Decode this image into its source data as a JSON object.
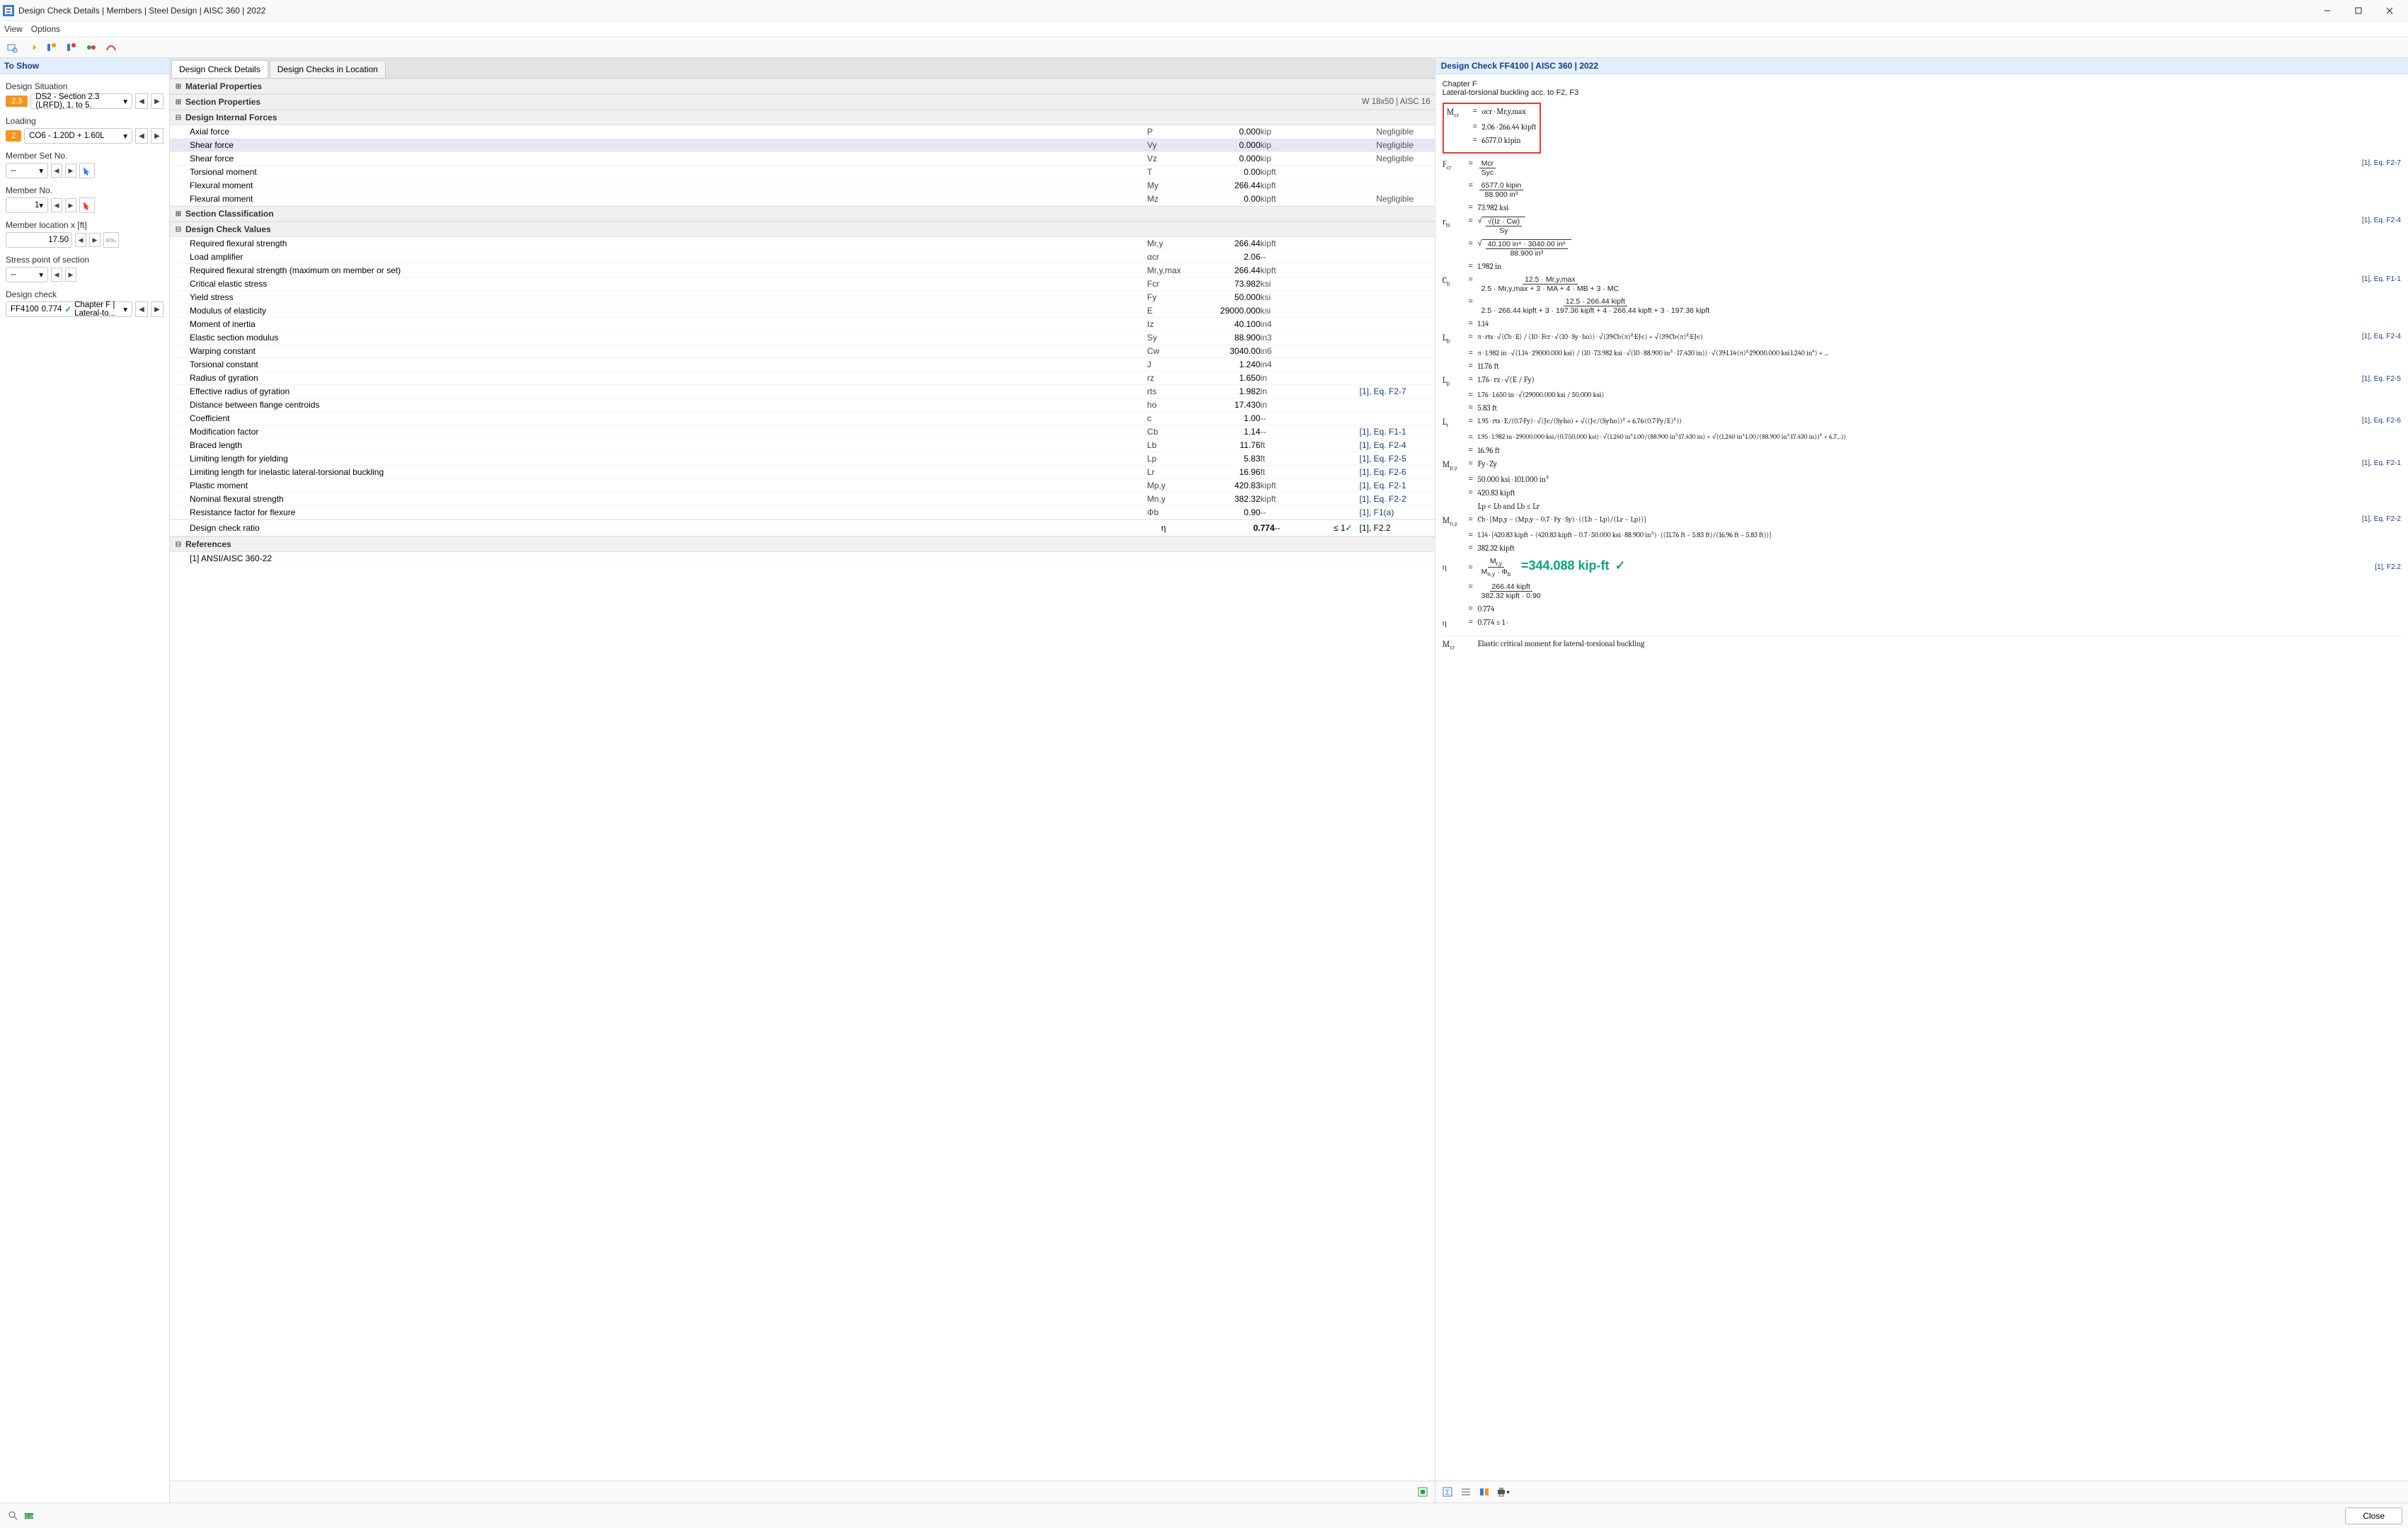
{
  "window": {
    "title": "Design Check Details | Members | Steel Design | AISC 360 | 2022"
  },
  "menus": {
    "view": "View",
    "options": "Options"
  },
  "leftPane": {
    "header": "To Show",
    "designSituationLabel": "Design Situation",
    "dsBadge": "2.3",
    "dsText": "DS2 - Section 2.3 (LRFD), 1. to 5.",
    "loadingLabel": "Loading",
    "loadBadge": "2",
    "loadText": "CO6 - 1.20D + 1.60L",
    "memberSetLabel": "Member Set No.",
    "memberSetVal": "--",
    "memberNoLabel": "Member No.",
    "memberNoVal": "1",
    "memberLocLabel": "Member location x [ft]",
    "memberLocVal": "17.50",
    "spLabel": "Stress point of section",
    "spVal": "--",
    "dcLabel": "Design check",
    "dcCode": "FF4100",
    "dcRatio": "0.774",
    "dcText": "Chapter F | Lateral-to..."
  },
  "midPane": {
    "tab1": "Design Check Details",
    "tab2": "Design Checks in Location",
    "groups": {
      "matProps": "Material Properties",
      "secProps": "Section Properties",
      "secPropExtra": "W 18x50 | AISC 16",
      "forces": "Design Internal Forces",
      "secClass": "Section Classification",
      "dcv": "Design Check Values",
      "refs": "References"
    },
    "forces": [
      {
        "name": "Axial force",
        "sym": "P",
        "val": "0.000",
        "unit": "kip",
        "note": "Negligible"
      },
      {
        "name": "Shear force",
        "sym": "Vy",
        "val": "0.000",
        "unit": "kip",
        "note": "Negligible",
        "sel": true
      },
      {
        "name": "Shear force",
        "sym": "Vz",
        "val": "0.000",
        "unit": "kip",
        "note": "Negligible"
      },
      {
        "name": "Torsional moment",
        "sym": "T",
        "val": "0.00",
        "unit": "kipft",
        "note": ""
      },
      {
        "name": "Flexural moment",
        "sym": "My",
        "val": "266.44",
        "unit": "kipft",
        "note": ""
      },
      {
        "name": "Flexural moment",
        "sym": "Mz",
        "val": "0.00",
        "unit": "kipft",
        "note": "Negligible"
      }
    ],
    "dcv": [
      {
        "name": "Required flexural strength",
        "sym": "Mr,y",
        "val": "266.44",
        "unit": "kipft",
        "ref": ""
      },
      {
        "name": "Load amplifier",
        "sym": "αcr",
        "val": "2.06",
        "unit": "--",
        "ref": ""
      },
      {
        "name": "Required flexural strength (maximum on member or set)",
        "sym": "Mr,y,max",
        "val": "266.44",
        "unit": "kipft",
        "ref": ""
      },
      {
        "name": "Critical elastic stress",
        "sym": "Fcr",
        "val": "73.982",
        "unit": "ksi",
        "ref": ""
      },
      {
        "name": "Yield stress",
        "sym": "Fy",
        "val": "50.000",
        "unit": "ksi",
        "ref": ""
      },
      {
        "name": "Modulus of elasticity",
        "sym": "E",
        "val": "29000.000",
        "unit": "ksi",
        "ref": ""
      },
      {
        "name": "Moment of inertia",
        "sym": "Iz",
        "val": "40.100",
        "unit": "in4",
        "ref": ""
      },
      {
        "name": "Elastic section modulus",
        "sym": "Sy",
        "val": "88.900",
        "unit": "in3",
        "ref": ""
      },
      {
        "name": "Warping constant",
        "sym": "Cw",
        "val": "3040.00",
        "unit": "in6",
        "ref": ""
      },
      {
        "name": "Torsional constant",
        "sym": "J",
        "val": "1.240",
        "unit": "in4",
        "ref": ""
      },
      {
        "name": "Radius of gyration",
        "sym": "rz",
        "val": "1.650",
        "unit": "in",
        "ref": ""
      },
      {
        "name": "Effective radius of gyration",
        "sym": "rts",
        "val": "1.982",
        "unit": "in",
        "ref": "[1], Eq. F2-7"
      },
      {
        "name": "Distance between flange centroids",
        "sym": "ho",
        "val": "17.430",
        "unit": "in",
        "ref": ""
      },
      {
        "name": "Coefficient",
        "sym": "c",
        "val": "1.00",
        "unit": "--",
        "ref": ""
      },
      {
        "name": "Modification factor",
        "sym": "Cb",
        "val": "1.14",
        "unit": "--",
        "ref": "[1], Eq. F1-1"
      },
      {
        "name": "Braced length",
        "sym": "Lb",
        "val": "11.76",
        "unit": "ft",
        "ref": "[1], Eq. F2-4"
      },
      {
        "name": "Limiting length for yielding",
        "sym": "Lp",
        "val": "5.83",
        "unit": "ft",
        "ref": "[1], Eq. F2-5"
      },
      {
        "name": "Limiting length for inelastic lateral-torsional buckling",
        "sym": "Lr",
        "val": "16.96",
        "unit": "ft",
        "ref": "[1], Eq. F2-6"
      },
      {
        "name": "Plastic moment",
        "sym": "Mp,y",
        "val": "420.83",
        "unit": "kipft",
        "ref": "[1], Eq. F2-1"
      },
      {
        "name": "Nominal flexural strength",
        "sym": "Mn,y",
        "val": "382.32",
        "unit": "kipft",
        "ref": "[1], Eq. F2-2"
      },
      {
        "name": "Resistance factor for flexure",
        "sym": "Φb",
        "val": "0.90",
        "unit": "--",
        "ref": "[1], F1(a)"
      }
    ],
    "ratio": {
      "name": "Design check ratio",
      "sym": "η",
      "val": "0.774",
      "unit": "--",
      "limit": "≤ 1",
      "ref": "[1], F2.2"
    },
    "ref1": "[1]  ANSI/AISC 360-22"
  },
  "rightPane": {
    "header": "Design Check FF4100 | AISC 360 | 2022",
    "chapter": "Chapter F",
    "desc": "Lateral-torsional buckling acc. to F2, F3",
    "mcr_l1": "αcr · Mr,y,max",
    "mcr_l2": "2.06 · 266.44 kipft",
    "mcr_l3": "6577.0 kipin",
    "fcr_top": "Mcr",
    "fcr_bot": "Syc",
    "fcr_n_top": "6577.0 kipin",
    "fcr_n_bot": "88.900 in³",
    "fcr_res": "73.982 ksi",
    "fcr_ref": "[1], Eq. F2-7",
    "rts_top": "√(Iz · Cw)",
    "rts_bot": "Sy",
    "rts_n_top": "40.100 in⁴ · 3040.00 in⁶",
    "rts_n_bot": "88.900 in³",
    "rts_res": "1.982 in",
    "rts_ref": "[1], Eq. F2-4",
    "cb_top": "12.5 · Mr,y,max",
    "cb_bot": "2.5 · Mr,y,max + 3 · MA + 4 · MB + 3 · MC",
    "cb_n_top": "12.5 · 266.44 kipft",
    "cb_n_bot": "2.5 · 266.44 kipft + 3 · 197.36 kipft + 4 · 266.44 kipft + 3 · 197.36 kipft",
    "cb_res": "1.14",
    "cb_ref": "[1], Eq. F1-1",
    "lb_expr": "π · rts · √(Cb · E) / (10 · Fcr · √(10 · Sy · ho)) · √(39·Cb·(π)²·E·J·c) + √(39·Cb·(π)²·E·J·c)",
    "lb_num": "π · 1.982 in · √(1.14 · 29000.000 ksi) / (10 · 73.982 ksi · √(10 · 88.900 in³ · 17.430 in)) · √(39·1.14·(π)²·29000.000 ksi·1.240 in⁴) + ...",
    "lb_res": "11.76 ft",
    "lp_expr": "1.76 · rz · √(E / Fy)",
    "lp_num": "1.76 · 1.650 in · √(29000.000 ksi / 50.000 ksi)",
    "lp_res": "5.83 ft",
    "lp_ref": "[1], Eq. F2-5",
    "lr_expr": "1.95 · rts · E/(0.7·Fy) · √(J·c/(Sy·ho) + √((J·c/(Sy·ho))² + 6.76·(0.7·Fy/E)²))",
    "lr_num": "1.95 · 1.982 in · 29000.000 ksi/(0.7·50.000 ksi) · √(1.240 in⁴·1.00/(88.900 in³·17.430 in) + √((1.240 in⁴·1.00/(88.900 in³·17.430 in))² + 6.7...))",
    "lr_res": "16.96 ft",
    "lr_ref": "[1], Eq. F2-6",
    "mpy_expr": "Fy · Zy",
    "mpy_num": "50.000 ksi · 101.000 in³",
    "mpy_res": "420.83 kipft",
    "mpy_ref": "[1], Eq. F2-1",
    "cond": "Lp < Lb and Lb ≤ Lr",
    "mny_expr": "Cb · [Mp,y − (Mp,y − 0.7 · Fy · Sy) · ((Lb − Lp)/(Lr − Lp))]",
    "mny_num": "1.14 · [420.83 kipft − (420.83 kipft − 0.7 · 50.000 ksi · 88.900 in³) · ((11.76 ft − 5.83 ft)/(16.96 ft − 5.83 ft))]",
    "mny_res": "382.32 kipft",
    "mny_ref": "[1], Eq. F2-2",
    "eta_expr": "Mr,y / (Mn,y · Φb)",
    "eta_num_top": "266.44 kipft",
    "eta_num_bot": "382.32 kipft · 0.90",
    "eta_res": "0.774",
    "eta_limit": "0.774 ≤ 1 ·",
    "eta_ref": "[1], F2.2",
    "result": "=344.088 kip-ft",
    "mcr_note": "Elastic critical moment for lateral-torsional buckling"
  },
  "footer": {
    "close": "Close"
  }
}
